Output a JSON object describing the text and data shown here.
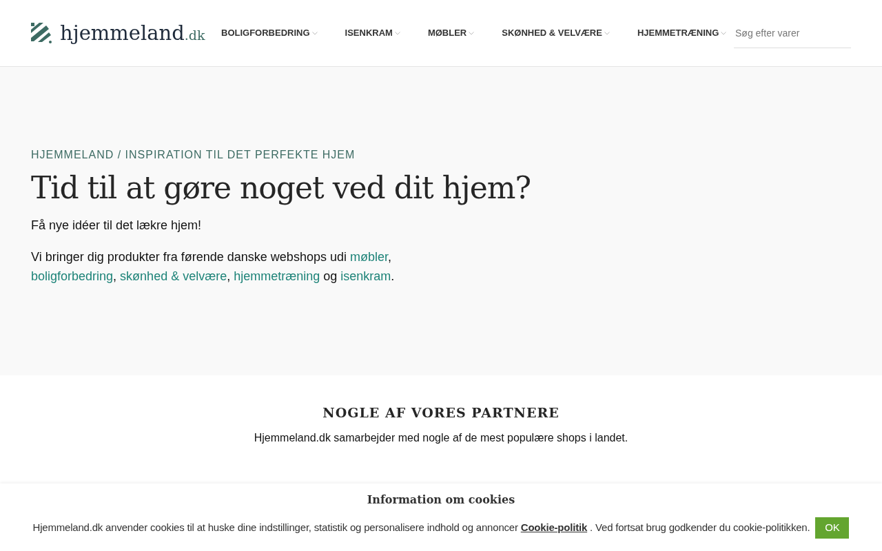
{
  "header": {
    "logo": {
      "name": "hjemmeland",
      "suffix": ".dk"
    },
    "nav": [
      {
        "label": "BOLIGFORBEDRING"
      },
      {
        "label": "ISENKRAM"
      },
      {
        "label": "MØBLER"
      },
      {
        "label": "SKØNHED & VELVÆRE"
      },
      {
        "label": "HJEMMETRÆNING"
      }
    ],
    "search": {
      "placeholder": "Søg efter varer"
    }
  },
  "hero": {
    "breadcrumb": "HJEMMELAND / INSPIRATION TIL DET PERFEKTE HJEM",
    "title": "Tid til at gøre noget ved dit hjem?",
    "subtitle": "Få nye idéer til det lækre hjem!",
    "paragraph": [
      {
        "kind": "text",
        "text": "Vi bringer dig produkter fra førende danske webshops udi "
      },
      {
        "kind": "link",
        "text": "møbler"
      },
      {
        "kind": "text",
        "text": ", "
      },
      {
        "kind": "link",
        "text": "boligforbedring"
      },
      {
        "kind": "text",
        "text": ", "
      },
      {
        "kind": "link",
        "text": "skønhed & velvære"
      },
      {
        "kind": "text",
        "text": ", "
      },
      {
        "kind": "link",
        "text": "hjemmetræning"
      },
      {
        "kind": "text",
        "text": " og "
      },
      {
        "kind": "link",
        "text": "isenkram"
      },
      {
        "kind": "text",
        "text": "."
      }
    ]
  },
  "partners": {
    "title": "NOGLE AF VORES PARTNERE",
    "text": "Hjemmeland.dk samarbejder med nogle af de mest populære shops i landet."
  },
  "cookie_banner": {
    "title": "Information om cookies",
    "text_before": "Hjemmeland.dk anvender cookies til at huske dine indstillinger, statistik og personalisere indhold og annoncer ",
    "link": "Cookie-politik",
    "text_after": " . Ved fortsat brug godkender du cookie-politikken.",
    "button": "OK"
  }
}
